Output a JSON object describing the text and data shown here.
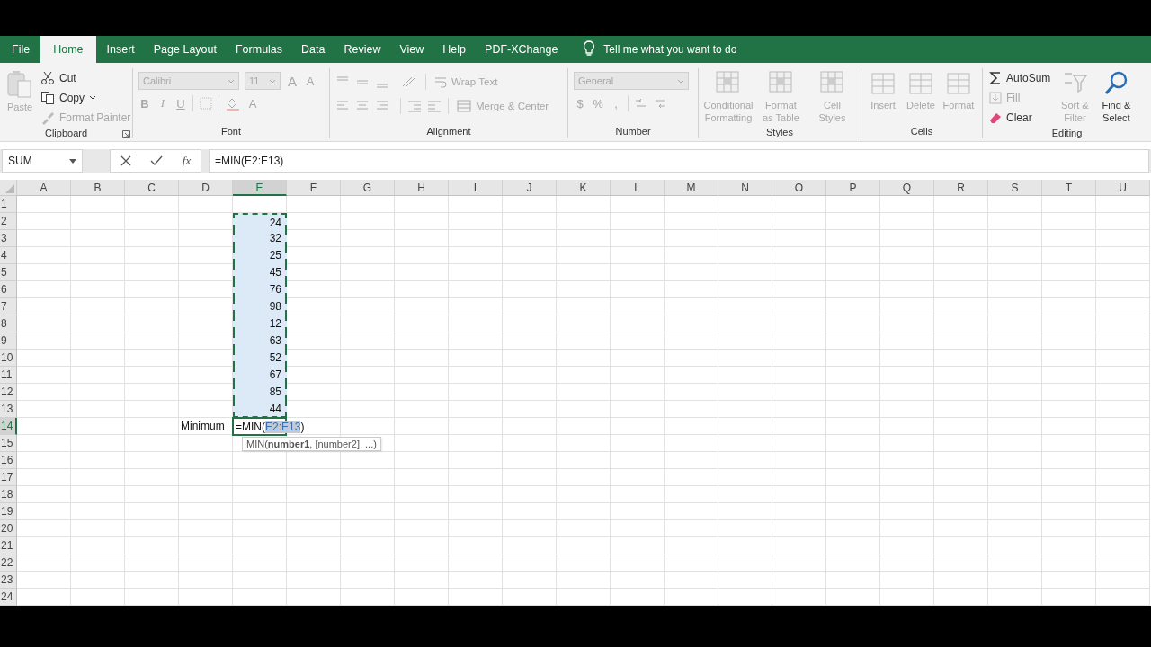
{
  "tabs": [
    {
      "label": "File",
      "selected": false
    },
    {
      "label": "Home",
      "selected": true
    },
    {
      "label": "Insert",
      "selected": false
    },
    {
      "label": "Page Layout",
      "selected": false
    },
    {
      "label": "Formulas",
      "selected": false
    },
    {
      "label": "Data",
      "selected": false
    },
    {
      "label": "Review",
      "selected": false
    },
    {
      "label": "View",
      "selected": false
    },
    {
      "label": "Help",
      "selected": false
    },
    {
      "label": "PDF-XChange",
      "selected": false
    }
  ],
  "tell_me": "Tell me what you want to do",
  "clipboard": {
    "label": "Clipboard",
    "paste": {
      "label": "Paste",
      "disabled": true
    },
    "cut": {
      "label": "Cut",
      "disabled": false
    },
    "copy": {
      "label": "Copy",
      "disabled": false
    },
    "format_painter": {
      "label": "Format Painter",
      "disabled": true
    }
  },
  "font": {
    "label": "Font",
    "font_name": "Calibri",
    "font_size": "11",
    "grow": "A",
    "shrink": "A",
    "bold": "B",
    "italic": "I",
    "underline": "U",
    "font_color": "A",
    "disabled": true
  },
  "alignment": {
    "label": "Alignment",
    "wrap_text": "Wrap Text",
    "merge_center": "Merge & Center",
    "disabled": true
  },
  "number": {
    "label": "Number",
    "format": "General",
    "currency": "$",
    "percent": "%",
    "comma": ",",
    "disabled": true
  },
  "styles": {
    "label": "Styles",
    "buttons": [
      "Conditional Formatting",
      "Format as Table",
      "Cell Styles"
    ],
    "disabled": true
  },
  "cells": {
    "label": "Cells",
    "buttons": [
      "Insert",
      "Delete",
      "Format"
    ],
    "disabled": true
  },
  "editing": {
    "label": "Editing",
    "autosum": {
      "label": "AutoSum",
      "disabled": false
    },
    "fill": {
      "label": "Fill",
      "disabled": true
    },
    "clear": {
      "label": "Clear",
      "disabled": false
    },
    "sort_filter": {
      "label": "Sort & Filter",
      "disabled": true
    },
    "find_select": {
      "label": "Find & Select",
      "disabled": false
    }
  },
  "name_box": "SUM",
  "function_glyph": "fx",
  "formula": "=MIN(E2:E13)",
  "columns": [
    {
      "label": "A",
      "selected": false
    },
    {
      "label": "B",
      "selected": false
    },
    {
      "label": "C",
      "selected": false
    },
    {
      "label": "D",
      "selected": false
    },
    {
      "label": "E",
      "selected": true
    },
    {
      "label": "F",
      "selected": false
    },
    {
      "label": "G",
      "selected": false
    },
    {
      "label": "H",
      "selected": false
    },
    {
      "label": "I",
      "selected": false
    },
    {
      "label": "J",
      "selected": false
    },
    {
      "label": "K",
      "selected": false
    },
    {
      "label": "L",
      "selected": false
    },
    {
      "label": "M",
      "selected": false
    },
    {
      "label": "N",
      "selected": false
    },
    {
      "label": "O",
      "selected": false
    },
    {
      "label": "P",
      "selected": false
    },
    {
      "label": "Q",
      "selected": false
    },
    {
      "label": "R",
      "selected": false
    },
    {
      "label": "S",
      "selected": false
    },
    {
      "label": "T",
      "selected": false
    },
    {
      "label": "U",
      "selected": false
    }
  ],
  "rows": [
    {
      "label": "1",
      "selected": false
    },
    {
      "label": "2",
      "selected": false,
      "cells": {
        "E": {
          "value": "24",
          "in_copy_range": true
        }
      }
    },
    {
      "label": "3",
      "selected": false,
      "cells": {
        "E": {
          "value": "32",
          "in_copy_range": true
        }
      }
    },
    {
      "label": "4",
      "selected": false,
      "cells": {
        "E": {
          "value": "25",
          "in_copy_range": true
        }
      }
    },
    {
      "label": "5",
      "selected": false,
      "cells": {
        "E": {
          "value": "45",
          "in_copy_range": true
        }
      }
    },
    {
      "label": "6",
      "selected": false,
      "cells": {
        "E": {
          "value": "76",
          "in_copy_range": true
        }
      }
    },
    {
      "label": "7",
      "selected": false,
      "cells": {
        "E": {
          "value": "98",
          "in_copy_range": true
        }
      }
    },
    {
      "label": "8",
      "selected": false,
      "cells": {
        "E": {
          "value": "12",
          "in_copy_range": true
        }
      }
    },
    {
      "label": "9",
      "selected": false,
      "cells": {
        "E": {
          "value": "63",
          "in_copy_range": true
        }
      }
    },
    {
      "label": "10",
      "selected": false,
      "cells": {
        "E": {
          "value": "52",
          "in_copy_range": true
        }
      }
    },
    {
      "label": "11",
      "selected": false,
      "cells": {
        "E": {
          "value": "67",
          "in_copy_range": true
        }
      }
    },
    {
      "label": "12",
      "selected": false,
      "cells": {
        "E": {
          "value": "85",
          "in_copy_range": true
        }
      }
    },
    {
      "label": "13",
      "selected": false,
      "cells": {
        "E": {
          "value": "44",
          "in_copy_range": true
        }
      }
    },
    {
      "label": "14",
      "selected": true,
      "cells": {
        "D": {
          "value": "Minimum",
          "in_copy_range": false
        },
        "E": {
          "editing": true,
          "prefix": "=MIN(",
          "reference": "E2:E13",
          "suffix": ")"
        }
      }
    },
    {
      "label": "15",
      "selected": false
    },
    {
      "label": "16",
      "selected": false
    },
    {
      "label": "17",
      "selected": false
    },
    {
      "label": "18",
      "selected": false
    },
    {
      "label": "19",
      "selected": false
    },
    {
      "label": "20",
      "selected": false
    },
    {
      "label": "21",
      "selected": false
    },
    {
      "label": "22",
      "selected": false
    },
    {
      "label": "23",
      "selected": false
    },
    {
      "label": "24",
      "selected": false
    }
  ],
  "tooltip": "MIN(**number1**, [number2], ...)"
}
